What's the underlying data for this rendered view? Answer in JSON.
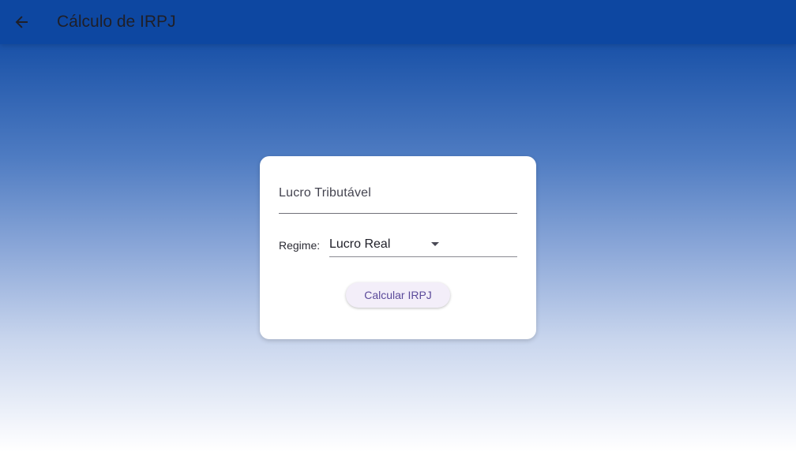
{
  "app_bar": {
    "back_icon": "arrow-left-icon",
    "title": "Cálculo de IRPJ",
    "color": "#0d47a1"
  },
  "form": {
    "lucro_field": {
      "label": "Lucro Tributável",
      "value": ""
    },
    "regime": {
      "label": "Regime:",
      "selected": "Lucro Real",
      "icon": "dropdown-arrow-icon"
    },
    "calculate_button": {
      "label": "Calcular IRPJ"
    }
  },
  "colors": {
    "primary": "#0d47a1",
    "button_text": "#5b4a9a",
    "button_bg": "#f3eef9"
  }
}
